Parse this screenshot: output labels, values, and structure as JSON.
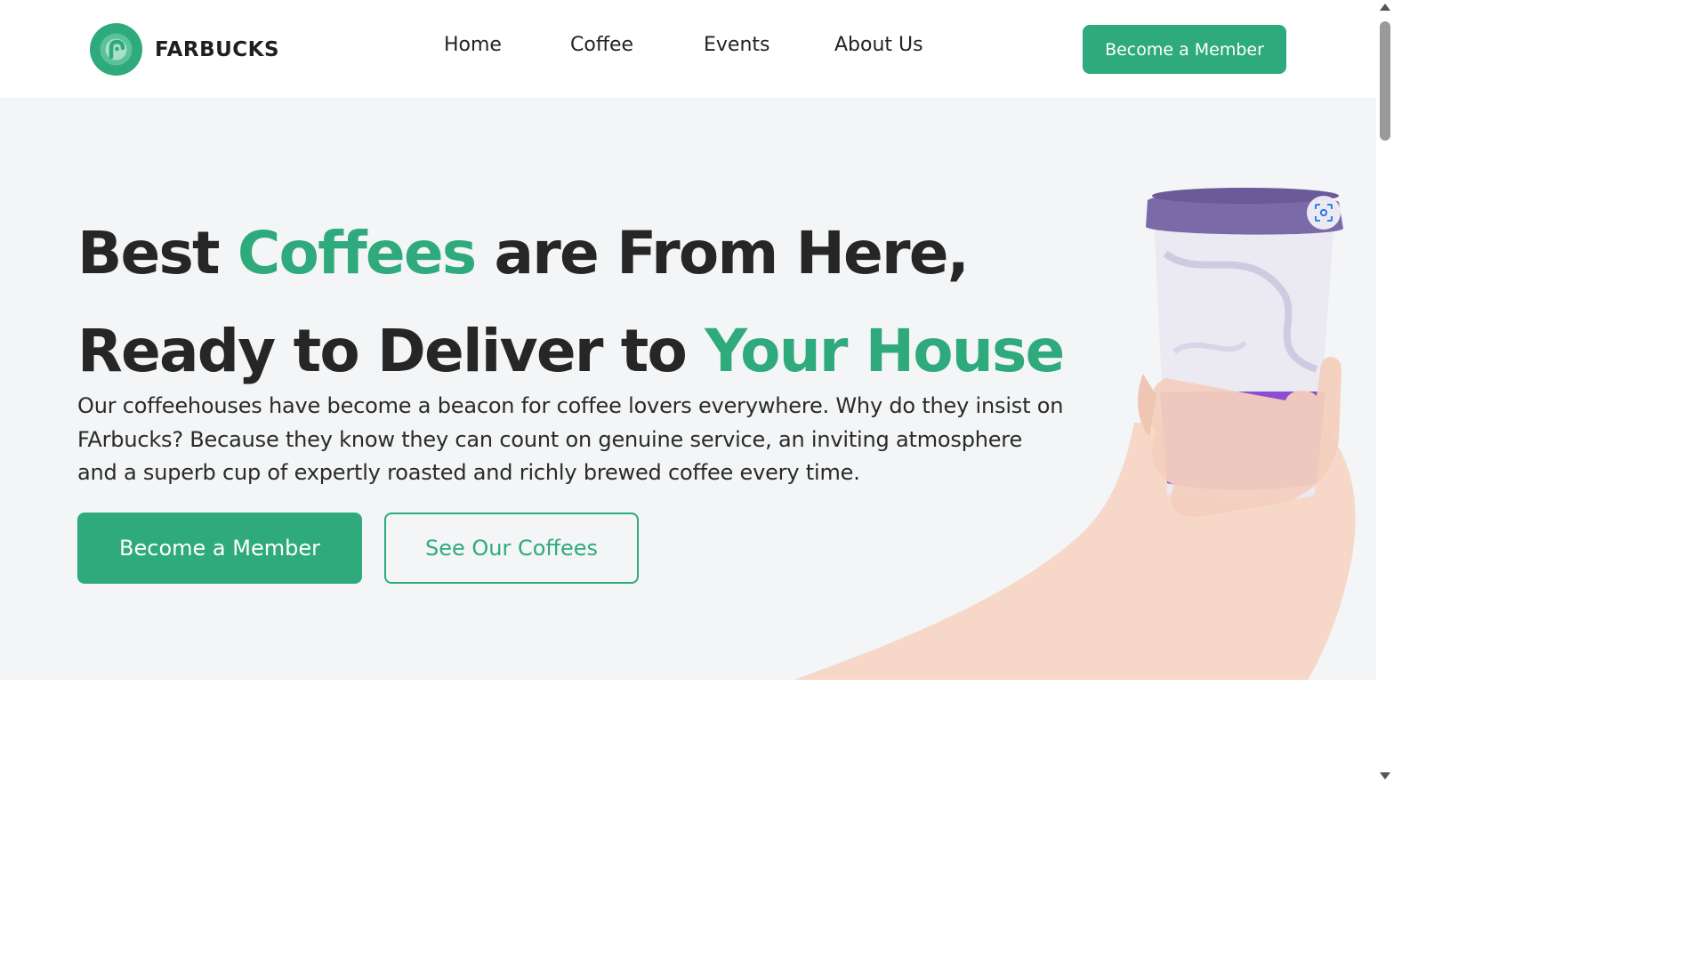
{
  "brand": {
    "name": "FARBUCKS",
    "accent_color": "#2eaa7d",
    "logo_icon": "leaf-swirl-logo"
  },
  "nav": {
    "items": [
      {
        "label": "Home"
      },
      {
        "label": "Coffee"
      },
      {
        "label": "Events"
      },
      {
        "label": "About Us"
      }
    ],
    "cta_label": "Become a Member"
  },
  "hero": {
    "headline": {
      "line1_a": "Best ",
      "line1_accent": "Coffees",
      "line1_b": " are From Here,",
      "line2_a": "Ready to Deliver to ",
      "line2_accent": "Your House"
    },
    "description": "Our coffeehouses have become a beacon for coffee lovers everywhere. Why do they insist on FArbucks? Because they know they can count on genuine service, an inviting atmosphere and a superb cup of expertly roasted and richly brewed coffee every time.",
    "primary_button": "Become a Member",
    "secondary_button": "See Our Coffees",
    "image_subject": "hand-holding-reusable-coffee-cup",
    "cup_colors": {
      "lid": "#7b6aa8",
      "sleeve": "#8a4fd0",
      "body": "#e9e8f0"
    }
  },
  "icons": {
    "lens": "image-search-icon"
  }
}
